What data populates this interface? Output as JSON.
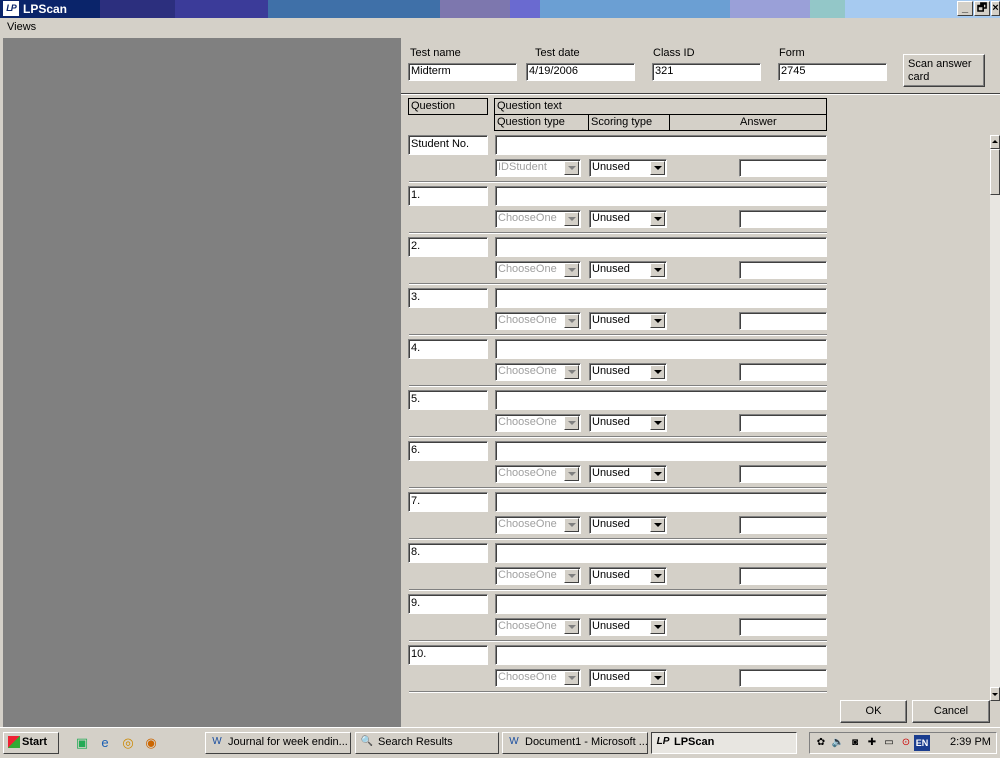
{
  "window": {
    "title": "LPScan",
    "icon_text": "LP",
    "controls": {
      "minimize": "_",
      "restore": "🗗",
      "close": "×"
    }
  },
  "menu": {
    "items": [
      "Views"
    ]
  },
  "header": {
    "test_name_label": "Test name",
    "test_name": "Midterm",
    "test_date_label": "Test date",
    "test_date": "4/19/2006",
    "class_id_label": "Class ID",
    "class_id": "321",
    "form_label": "Form",
    "form": "2745",
    "scan_button": "Scan answer card"
  },
  "columns": {
    "question": "Question",
    "question_text": "Question text",
    "question_type": "Question type",
    "scoring_type": "Scoring type",
    "answer": "Answer"
  },
  "rows": [
    {
      "label": "Student No.",
      "text": "",
      "qtype": "IDStudent",
      "scoring": "Unused",
      "answer": ""
    },
    {
      "label": "1.",
      "text": "",
      "qtype": "ChooseOne",
      "scoring": "Unused",
      "answer": ""
    },
    {
      "label": "2.",
      "text": "",
      "qtype": "ChooseOne",
      "scoring": "Unused",
      "answer": ""
    },
    {
      "label": "3.",
      "text": "",
      "qtype": "ChooseOne",
      "scoring": "Unused",
      "answer": ""
    },
    {
      "label": "4.",
      "text": "",
      "qtype": "ChooseOne",
      "scoring": "Unused",
      "answer": ""
    },
    {
      "label": "5.",
      "text": "",
      "qtype": "ChooseOne",
      "scoring": "Unused",
      "answer": ""
    },
    {
      "label": "6.",
      "text": "",
      "qtype": "ChooseOne",
      "scoring": "Unused",
      "answer": ""
    },
    {
      "label": "7.",
      "text": "",
      "qtype": "ChooseOne",
      "scoring": "Unused",
      "answer": ""
    },
    {
      "label": "8.",
      "text": "",
      "qtype": "ChooseOne",
      "scoring": "Unused",
      "answer": ""
    },
    {
      "label": "9.",
      "text": "",
      "qtype": "ChooseOne",
      "scoring": "Unused",
      "answer": ""
    },
    {
      "label": "10.",
      "text": "",
      "qtype": "ChooseOne",
      "scoring": "Unused",
      "answer": ""
    }
  ],
  "buttons": {
    "ok": "OK",
    "cancel": "Cancel"
  },
  "taskbar": {
    "start": "Start",
    "windows": [
      {
        "label": "Journal for week endin...",
        "icon": "word-doc-icon"
      },
      {
        "label": "Search Results",
        "icon": "search-icon"
      },
      {
        "label": "Document1 - Microsoft ...",
        "icon": "word-doc-icon"
      },
      {
        "label": "LPScan",
        "icon": "lpscan-icon"
      }
    ],
    "tray_lang": "EN",
    "clock": "2:39 PM"
  }
}
